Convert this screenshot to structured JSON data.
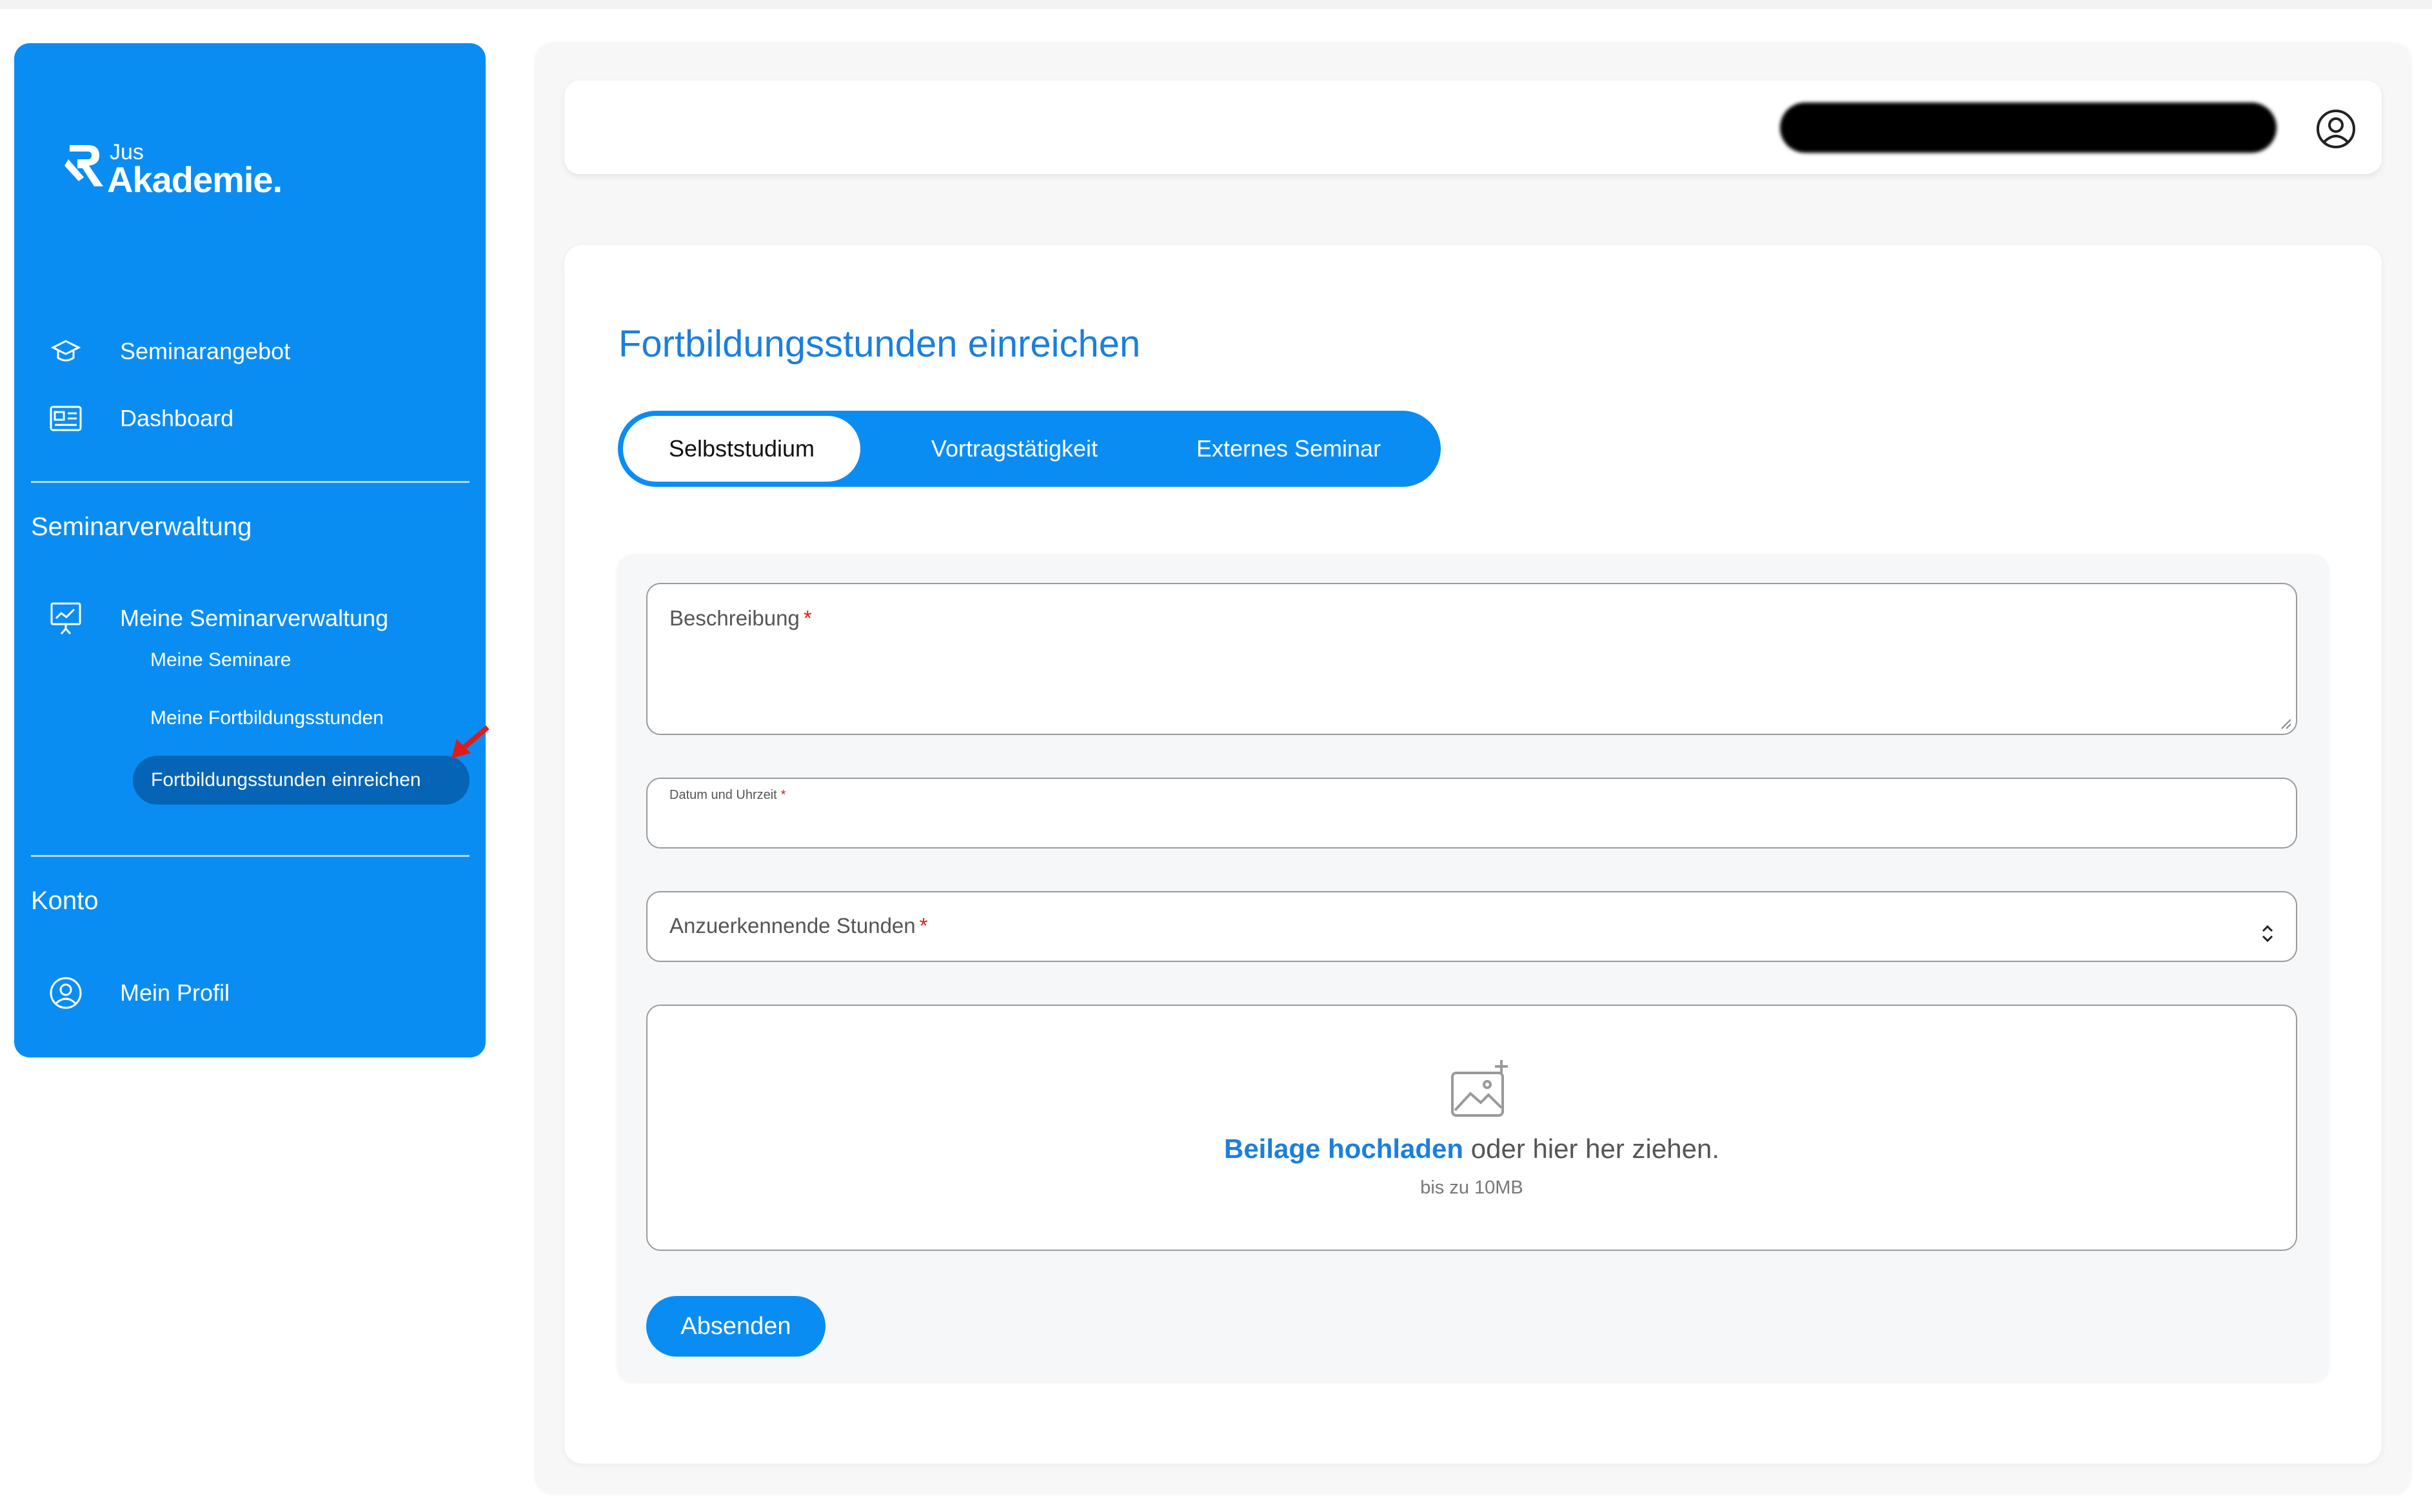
{
  "brand": {
    "small": "Jus",
    "name": "Akademie.",
    "color": "#0a8df3"
  },
  "sidebar": {
    "items": [
      {
        "label": "Seminarangebot",
        "icon": "graduation-cap-icon"
      },
      {
        "label": "Dashboard",
        "icon": "id-card-icon"
      }
    ],
    "section_manage": "Seminarverwaltung",
    "manage_item": {
      "label": "Meine Seminarverwaltung",
      "icon": "presentation-board-icon"
    },
    "sub_items": [
      "Meine Seminare",
      "Meine Fortbildungsstunden",
      "Fortbildungsstunden einreichen"
    ],
    "active_sub": "Fortbildungsstunden einreichen",
    "section_account": "Konto",
    "account_item": {
      "label": "Mein Profil",
      "icon": "user-circle-icon"
    }
  },
  "header": {
    "user_icon": "user-circle-icon"
  },
  "page": {
    "title": "Fortbildungsstunden einreichen",
    "tabs": [
      "Selbststudium",
      "Vortragstätigkeit",
      "Externes Seminar"
    ],
    "active_tab": "Selbststudium"
  },
  "form": {
    "description_label": "Beschreibung",
    "date_label": "Datum und Uhrzeit",
    "hours_label": "Anzuerkennende Stunden",
    "required_mark": "*",
    "upload": {
      "link": "Beilage hochladen",
      "text": " oder hier her ziehen.",
      "limit": "bis zu 10MB",
      "icon": "image-add-icon"
    },
    "submit": "Absenden"
  }
}
